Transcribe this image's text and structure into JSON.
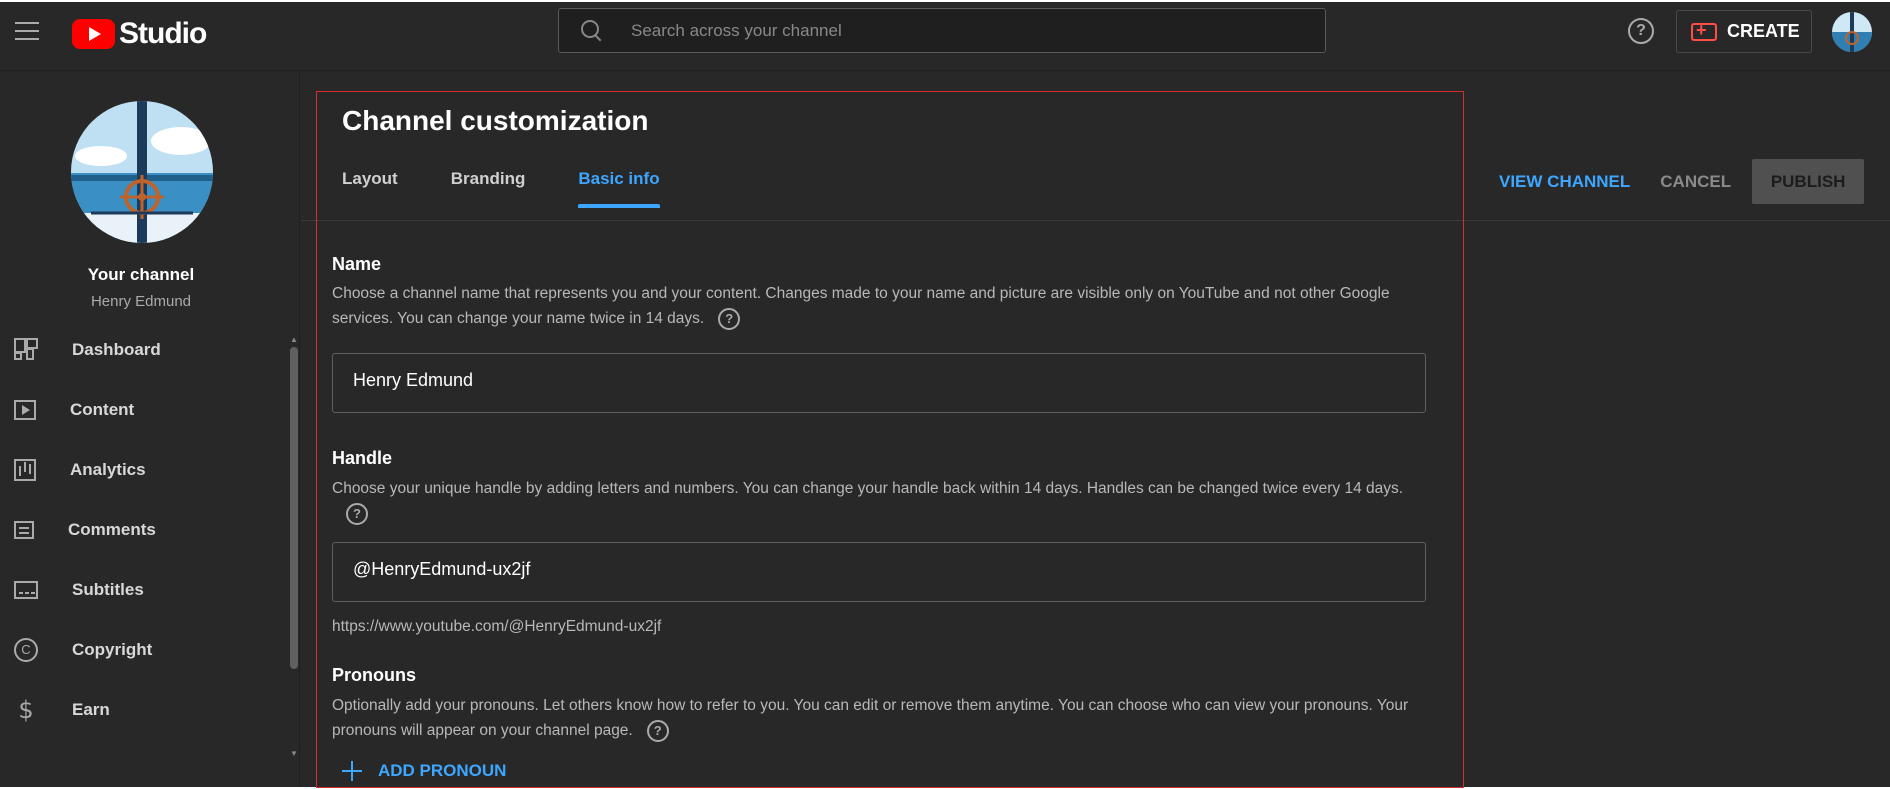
{
  "topbar": {
    "logo_text": "Studio",
    "search_placeholder": "Search across your channel",
    "create_label": "CREATE"
  },
  "sidebar": {
    "channel_title": "Your channel",
    "channel_name": "Henry Edmund",
    "items": [
      {
        "label": "Dashboard",
        "icon": "dashboard-icon"
      },
      {
        "label": "Content",
        "icon": "content-icon"
      },
      {
        "label": "Analytics",
        "icon": "analytics-icon"
      },
      {
        "label": "Comments",
        "icon": "comments-icon"
      },
      {
        "label": "Subtitles",
        "icon": "subtitles-icon"
      },
      {
        "label": "Copyright",
        "icon": "copyright-icon"
      },
      {
        "label": "Earn",
        "icon": "earn-icon"
      }
    ]
  },
  "main": {
    "title": "Channel customization",
    "tabs": [
      {
        "label": "Layout",
        "active": false
      },
      {
        "label": "Branding",
        "active": false
      },
      {
        "label": "Basic info",
        "active": true
      }
    ],
    "actions": {
      "view_channel": "VIEW CHANNEL",
      "cancel": "CANCEL",
      "publish": "PUBLISH"
    },
    "name": {
      "title": "Name",
      "description": "Choose a channel name that represents you and your content. Changes made to your name and picture are visible only on YouTube and not other Google services. You can change your name twice in 14 days.",
      "value": "Henry Edmund"
    },
    "handle": {
      "title": "Handle",
      "description": "Choose your unique handle by adding letters and numbers. You can change your handle back within 14 days. Handles can be changed twice every 14 days.",
      "value": "@HenryEdmund-ux2jf",
      "url": "https://www.youtube.com/@HenryEdmund-ux2jf"
    },
    "pronouns": {
      "title": "Pronouns",
      "description": "Optionally add your pronouns. Let others know how to refer to you. You can edit or remove them anytime. You can choose who can view your pronouns. Your pronouns will appear on your channel page.",
      "add_label": "ADD PRONOUN"
    }
  },
  "colors": {
    "background": "#282828",
    "accent_blue": "#3ea6ff",
    "brand_red": "#ff0000",
    "highlight_frame": "#d32f2f"
  }
}
